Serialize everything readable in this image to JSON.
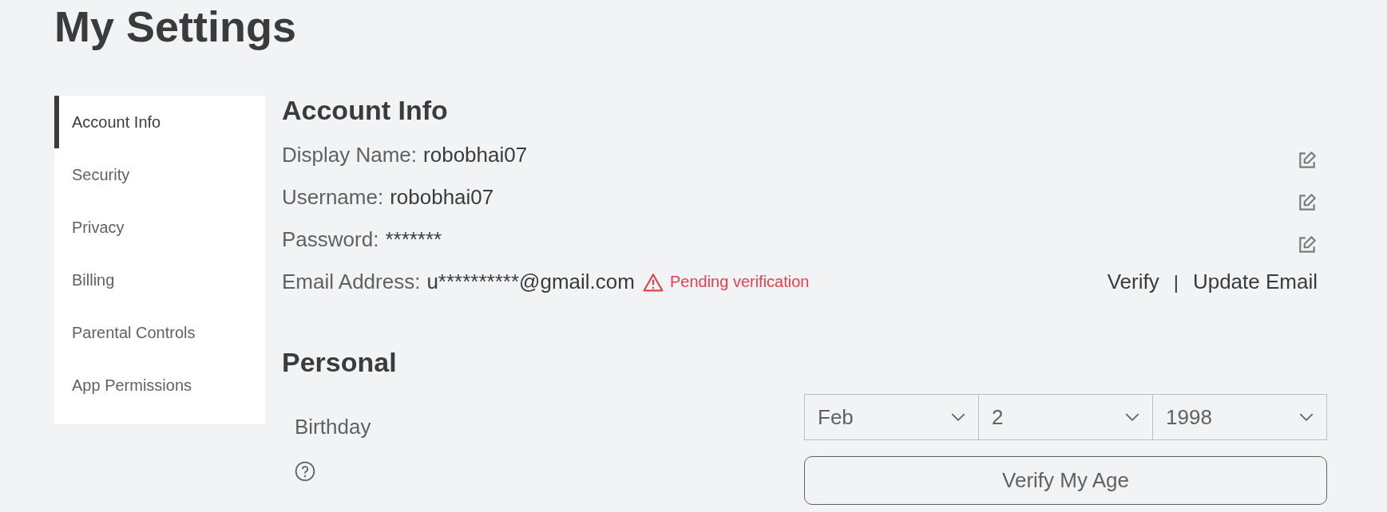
{
  "page": {
    "title": "My Settings"
  },
  "sidebar": {
    "items": [
      {
        "label": "Account Info",
        "selected": true
      },
      {
        "label": "Security",
        "selected": false
      },
      {
        "label": "Privacy",
        "selected": false
      },
      {
        "label": "Billing",
        "selected": false
      },
      {
        "label": "Parental Controls",
        "selected": false
      },
      {
        "label": "App Permissions",
        "selected": false
      }
    ]
  },
  "account_info": {
    "heading": "Account Info",
    "fields": [
      {
        "label": "Display Name:",
        "value": "robobhai07",
        "editable": true
      },
      {
        "label": "Username:",
        "value": "robobhai07",
        "editable": true
      },
      {
        "label": "Password:",
        "value": "*******",
        "editable": true
      }
    ],
    "email": {
      "label": "Email Address:",
      "value": "u**********@gmail.com",
      "status": "Pending verification",
      "links": [
        "Verify",
        "Update Email"
      ],
      "link_separator": "|"
    }
  },
  "personal": {
    "heading": "Personal",
    "birthday": {
      "label": "Birthday",
      "selects": [
        {
          "value": "Feb"
        },
        {
          "value": "2"
        },
        {
          "value": "1998"
        }
      ]
    },
    "button": "Verify My Age"
  }
}
